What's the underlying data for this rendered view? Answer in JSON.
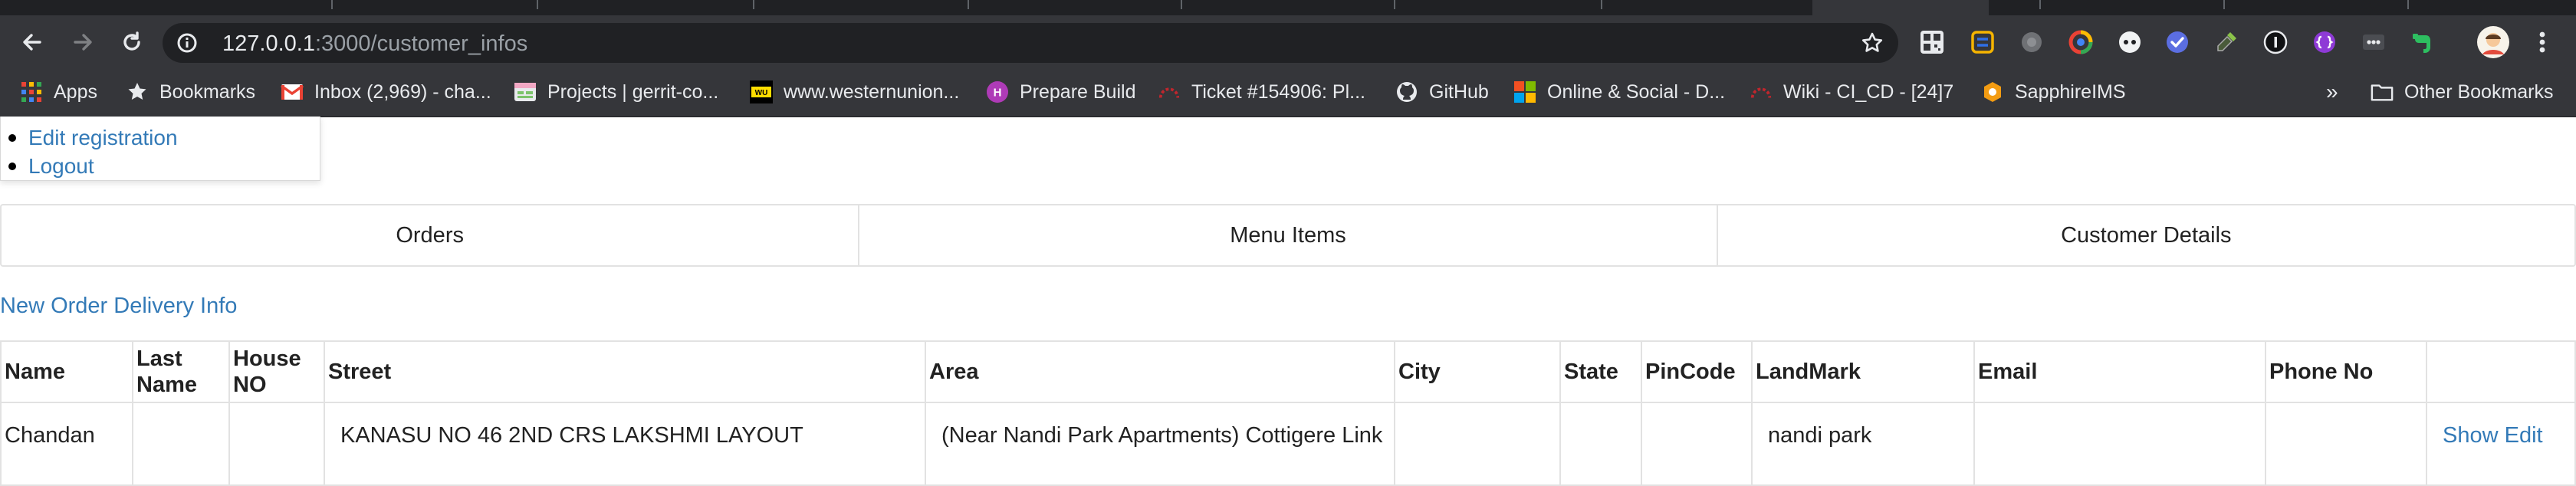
{
  "browser": {
    "url_host": "127.0.0.1",
    "url_path": ":3000/customer_infos"
  },
  "bookmarks": [
    {
      "label": "Apps",
      "icon": "apps-grid-icon"
    },
    {
      "label": "Bookmarks",
      "icon": "star-icon"
    },
    {
      "label": "Inbox (2,969) - cha...",
      "icon": "gmail-icon"
    },
    {
      "label": "Projects | gerrit-co...",
      "icon": "gerrit-icon"
    },
    {
      "label": "www.westernunion...",
      "icon": "western-union-icon"
    },
    {
      "label": "Prepare Build",
      "icon": "prepare-build-icon"
    },
    {
      "label": "Ticket #154906: Pl...",
      "icon": "ticket-icon"
    },
    {
      "label": "GitHub",
      "icon": "github-icon"
    },
    {
      "label": "Online & Social - D...",
      "icon": "microsoft-icon"
    },
    {
      "label": "Wiki - CI_CD - [24]7",
      "icon": "wiki-icon"
    },
    {
      "label": "SapphireIMS",
      "icon": "sapphire-icon"
    }
  ],
  "bookmarks_overflow": "»",
  "other_bookmarks": "Other Bookmarks",
  "account_menu": [
    {
      "label": "Edit registration"
    },
    {
      "label": "Logout"
    }
  ],
  "nav_tabs": [
    {
      "label": "Orders"
    },
    {
      "label": "Menu Items"
    },
    {
      "label": "Customer Details"
    }
  ],
  "new_link": "New Order Delivery Info",
  "table": {
    "headers": [
      "Name",
      "Last Name",
      "House NO",
      "Street",
      "Area",
      "City",
      "State",
      "PinCode",
      "LandMark",
      "Email",
      "Phone No",
      ""
    ],
    "rows": [
      {
        "name": "Chandan",
        "last_name": "",
        "house_no": "",
        "street": "KANASU NO 46 2ND CRS LAKSHMI LAYOUT",
        "area": "(Near Nandi Park Apartments) Cottigere Link",
        "city": "",
        "state": "",
        "pincode": "",
        "landmark": "nandi park",
        "email": "",
        "phone": "",
        "show_label": "Show",
        "edit_label": "Edit"
      }
    ]
  },
  "colors": {
    "link": "#337ab7",
    "chrome_dark": "#202124",
    "chrome_toolbar": "#35363a"
  }
}
